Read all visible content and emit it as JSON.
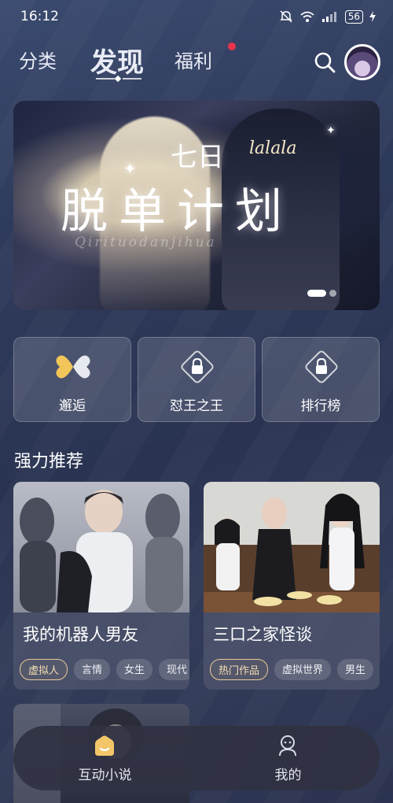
{
  "status_bar": {
    "time": "16:12",
    "battery": "56"
  },
  "top_nav": {
    "tabs": [
      {
        "label": "分类"
      },
      {
        "label": "发现"
      },
      {
        "label": "福利"
      }
    ],
    "active_tab": "发现",
    "notification_dot_color": "#e8344a"
  },
  "banner": {
    "prefix": "七日",
    "script": "lalala",
    "title": "脱单计划",
    "subtitle": "Qirituodanjihua",
    "page_count": 2,
    "active_page": 1
  },
  "features": [
    {
      "label": "邂逅",
      "icon": "butterfly-icon",
      "locked": false
    },
    {
      "label": "怼王之王",
      "icon": "lock-icon",
      "locked": true
    },
    {
      "label": "排行榜",
      "icon": "lock-icon",
      "locked": true
    }
  ],
  "section": {
    "title": "强力推荐"
  },
  "recommendations": [
    {
      "title": "我的机器人男友",
      "tags": [
        "虚拟人",
        "言情",
        "女生",
        "现代"
      ]
    },
    {
      "title": "三口之家怪谈",
      "tags": [
        "热门作品",
        "虚拟世界",
        "男生"
      ]
    }
  ],
  "bottom_nav": {
    "items": [
      {
        "label": "互动小说",
        "icon": "home-icon"
      },
      {
        "label": "我的",
        "icon": "profile-icon"
      }
    ]
  },
  "colors": {
    "accent_gold": "#e7c998",
    "background": "#2f3b5c"
  }
}
